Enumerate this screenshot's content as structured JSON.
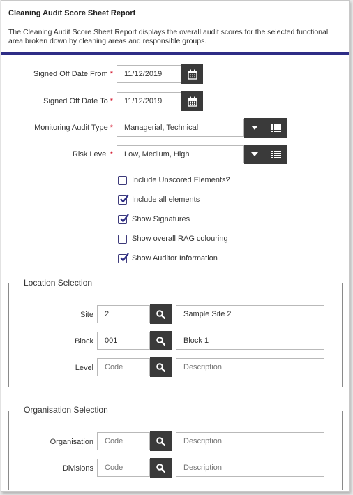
{
  "report": {
    "title": "Cleaning Audit Score Sheet Report",
    "description": "The Cleaning Audit Score Sheet Report displays the overall audit scores for the selected functional area broken down by cleaning areas and responsible groups."
  },
  "form": {
    "signed_off_from": {
      "label": "Signed Off Date From",
      "required_mark": "*",
      "value": "11/12/2019"
    },
    "signed_off_to": {
      "label": "Signed Off Date To",
      "required_mark": "*",
      "value": "11/12/2019"
    },
    "monitoring_audit_type": {
      "label": "Monitoring Audit Type",
      "required_mark": "*",
      "value": "Managerial, Technical"
    },
    "risk_level": {
      "label": "Risk Level",
      "required_mark": "*",
      "value": "Low, Medium, High"
    }
  },
  "options": [
    {
      "label": "Include Unscored Elements?",
      "checked": false
    },
    {
      "label": "Include all elements",
      "checked": true
    },
    {
      "label": "Show Signatures",
      "checked": true
    },
    {
      "label": "Show overall RAG colouring",
      "checked": false
    },
    {
      "label": "Show Auditor Information",
      "checked": true
    }
  ],
  "location": {
    "legend": "Location Selection",
    "site": {
      "label": "Site",
      "code": "2",
      "description": "Sample Site 2"
    },
    "block": {
      "label": "Block",
      "code": "001",
      "description": "Block 1"
    },
    "level": {
      "label": "Level",
      "code_placeholder": "Code",
      "description_placeholder": "Description"
    }
  },
  "organisation": {
    "legend": "Organisation Selection",
    "organisation": {
      "label": "Organisation",
      "code_placeholder": "Code",
      "description_placeholder": "Description"
    },
    "divisions": {
      "label": "Divisions",
      "code_placeholder": "Code",
      "description_placeholder": "Description"
    }
  },
  "icons": {
    "calendar": "calendar-icon",
    "dropdown": "chevron-down-icon",
    "list": "list-icon",
    "search": "search-icon",
    "check": "check-icon"
  },
  "colors": {
    "accent_rule": "#2e2d86",
    "button_dark": "#3a3a3a",
    "required": "#d0021b",
    "checkbox_border": "#3d3a7a"
  }
}
